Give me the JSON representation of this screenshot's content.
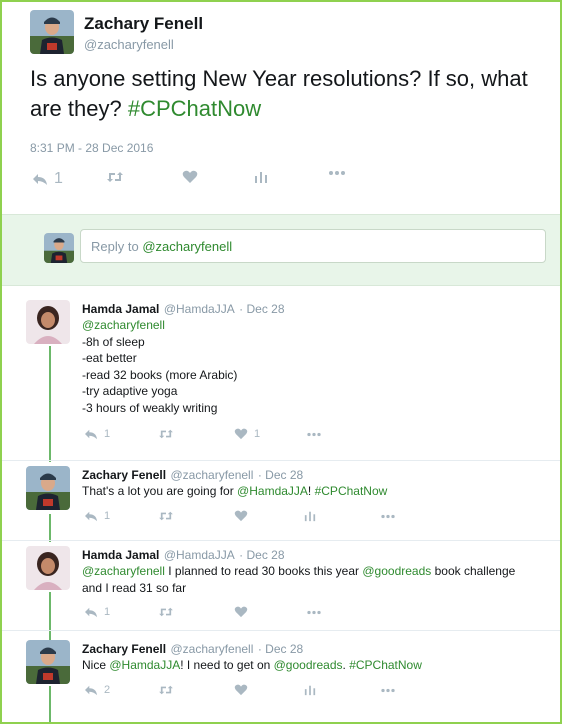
{
  "tweet": {
    "author_name": "Zachary Fenell",
    "author_handle": "@zacharyfenell",
    "text_before": "Is anyone setting New Year resolutions? If so, what are they? ",
    "hashtag": "#CPChatNow",
    "timestamp": "8:31 PM - 28 Dec 2016",
    "reply_count": "1",
    "avatar_icon": "profile-photo-zachary"
  },
  "reply_box": {
    "placeholder_prefix": "Reply to ",
    "placeholder_mention": "@zacharyfenell"
  },
  "replies": [
    {
      "author_name": "Hamda Jamal",
      "author_handle": "@HamdaJJA",
      "date": "· Dec 28",
      "mention": "@zacharyfenell",
      "lines": [
        "-8h of sleep",
        "-eat better",
        "-read 32 books (more Arabic)",
        "-try adaptive yoga",
        "-3 hours of weakly writing"
      ],
      "reply_count": "1",
      "like_count": "1"
    },
    {
      "author_name": "Zachary Fenell",
      "author_handle": "@zacharyfenell",
      "date": "· Dec 28",
      "text_before": "That's a lot you are going for ",
      "mention": "@HamdaJJA",
      "text_mid": "! ",
      "hashtag": "#CPChatNow",
      "reply_count": "1"
    },
    {
      "author_name": "Hamda Jamal",
      "author_handle": "@HamdaJJA",
      "date": "· Dec 28",
      "mention": "@zacharyfenell",
      "text_a": " I planned to read 30 books this year ",
      "mention2": "@goodreads",
      "text_b": " book challenge",
      "line2": "and I read 31 so far",
      "reply_count": "1"
    },
    {
      "author_name": "Zachary Fenell",
      "author_handle": "@zacharyfenell",
      "date": "· Dec 28",
      "text_before": "Nice ",
      "mention": "@HamdaJJA",
      "text_mid": "! I need to get on ",
      "mention2": "@goodreads",
      "text_end": ". ",
      "hashtag": "#CPChatNow",
      "reply_count": "2"
    }
  ],
  "colors": {
    "border": "#8fd14f",
    "link": "#2f8a2f",
    "thread_line": "#6cb86a",
    "icon_gray": "#aab8c2"
  }
}
